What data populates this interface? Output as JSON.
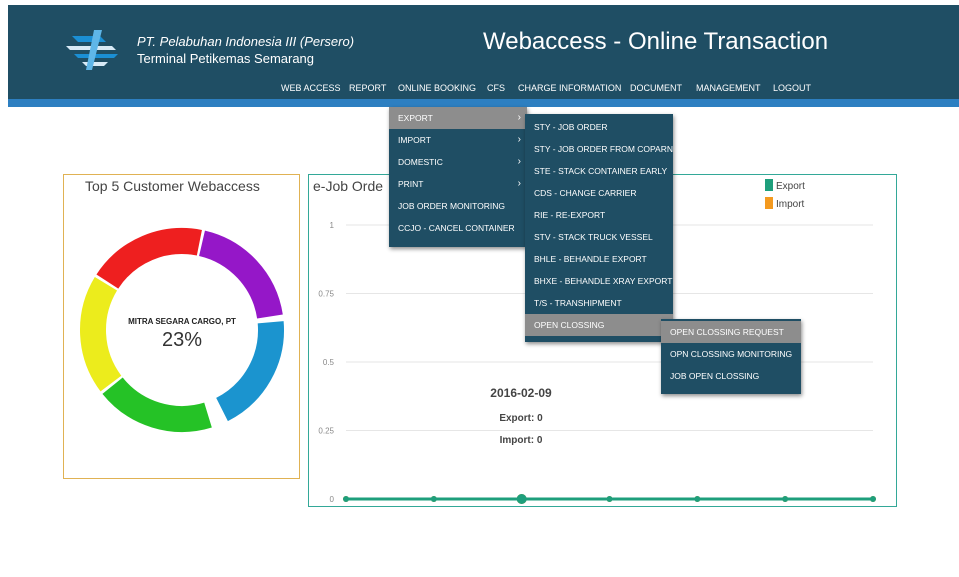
{
  "header": {
    "company_line1": "PT. Pelabuhan Indonesia III (Persero)",
    "company_line2": "Terminal Petikemas Semarang",
    "app_title": "Webaccess - Online Transaction"
  },
  "nav": [
    "WEB ACCESS",
    "REPORT",
    "ONLINE BOOKING",
    "CFS",
    "CHARGE INFORMATION",
    "DOCUMENT",
    "MANAGEMENT",
    "LOGOUT"
  ],
  "booking_menu": [
    {
      "label": "EXPORT",
      "arrow": "›"
    },
    {
      "label": "IMPORT",
      "arrow": "›"
    },
    {
      "label": "DOMESTIC",
      "arrow": "›"
    },
    {
      "label": "PRINT",
      "arrow": "›"
    },
    {
      "label": "JOB ORDER MONITORING"
    },
    {
      "label": "CCJO - CANCEL CONTAINER"
    }
  ],
  "export_menu": [
    "STY - JOB ORDER",
    "STY - JOB ORDER FROM COPARN",
    "STE - STACK CONTAINER EARLY",
    "CDS - CHANGE CARRIER",
    "RIE - RE-EXPORT",
    "STV - STACK TRUCK VESSEL",
    "BHLE - BEHANDLE EXPORT",
    "BHXE - BEHANDLE XRAY EXPORT",
    "T/S - TRANSHIPMENT",
    "OPEN CLOSSING"
  ],
  "open_clossing_menu": [
    "OPEN CLOSSING REQUEST",
    "OPN CLOSSING MONITORING",
    "JOB OPEN CLOSSING"
  ],
  "donut": {
    "title": "Top 5 Customer Webaccess",
    "center_label": "MITRA SEGARA CARGO, PT",
    "center_value": "23%",
    "colors": [
      "#1b94cf",
      "#25c226",
      "#ecec1c",
      "#ee1f1f",
      "#9517c8"
    ]
  },
  "chart_data": {
    "type": "line",
    "title": "e-Job Orde",
    "ylim": [
      0,
      1
    ],
    "y_ticks": [
      "0",
      "0.25",
      "0.5",
      "0.75",
      "1"
    ],
    "series": [
      {
        "name": "Export",
        "color": "#1e9f7c",
        "values": [
          0,
          0,
          0,
          0,
          0,
          0,
          0
        ]
      },
      {
        "name": "Import",
        "color": "#f49a1f",
        "values": [
          0,
          0,
          0,
          0,
          0,
          0,
          0
        ]
      }
    ],
    "grid": true,
    "legend": "top-right",
    "tooltip": {
      "date": "2016-02-09",
      "export": "Export: 0",
      "import": "Import: 0"
    }
  }
}
